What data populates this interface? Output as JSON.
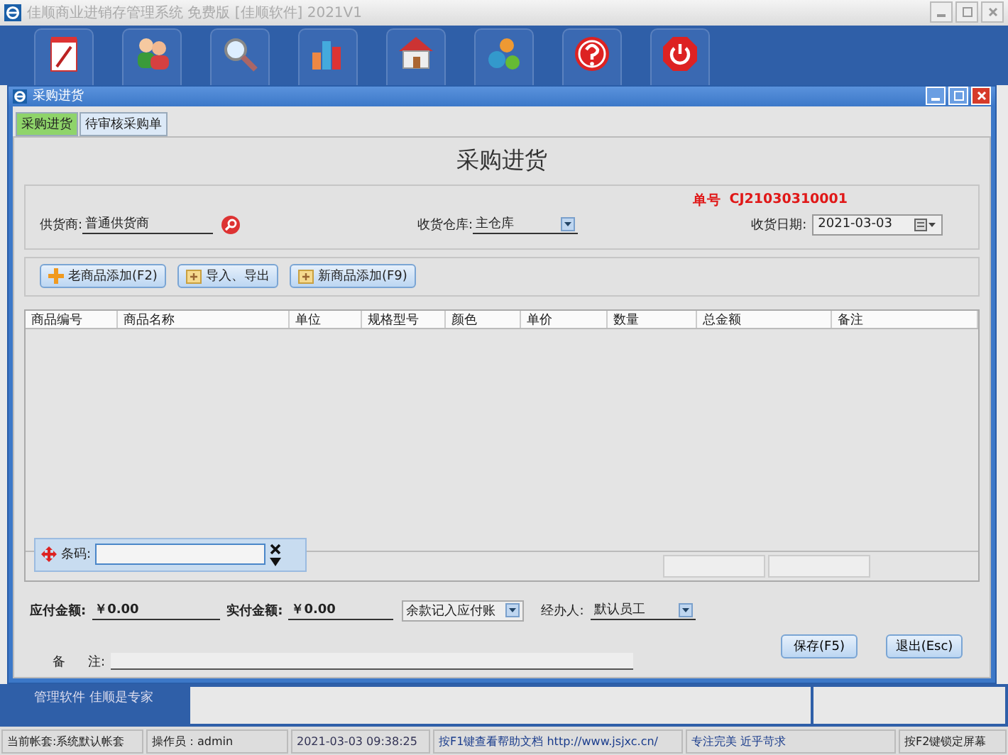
{
  "window": {
    "title": "佳顺商业进销存管理系统 免费版 [佳顺软件] 2021V1"
  },
  "toolbar": [
    {
      "kind": "note"
    },
    {
      "kind": "people"
    },
    {
      "kind": "search"
    },
    {
      "kind": "chart"
    },
    {
      "kind": "house"
    },
    {
      "kind": "abc"
    },
    {
      "kind": "help"
    },
    {
      "kind": "power"
    }
  ],
  "child_window": {
    "title": "采购进货"
  },
  "tabs": [
    {
      "label": "采购进货",
      "selected": true
    },
    {
      "label": "待审核采购单",
      "selected": false
    }
  ],
  "form": {
    "heading": "采购进货",
    "order_no_label": "单号",
    "order_no": "CJ21030310001",
    "supplier_label": "供货商:",
    "supplier": "普通供货商",
    "warehouse_label": "收货仓库:",
    "warehouse": "主仓库",
    "date_label": "收货日期:",
    "date": "2021-03-03"
  },
  "actions": [
    {
      "label": "老商品添加(F2)",
      "kind": "plus"
    },
    {
      "label": "导入、导出",
      "kind": "box"
    },
    {
      "label": "新商品添加(F9)",
      "kind": "box"
    }
  ],
  "table": {
    "columns": [
      "商品编号",
      "商品名称",
      "单位",
      "规格型号",
      "颜色",
      "单价",
      "数量",
      "总金额",
      "备注"
    ]
  },
  "barcode": {
    "label": "条码:"
  },
  "totals": {
    "payable_label": "应付金额:",
    "payable": "￥0.00",
    "paid_label": "实付金额:",
    "paid": "￥0.00",
    "balance_option": "余款记入应付账",
    "handler_label": "经办人:",
    "handler": "默认员工",
    "remark_label_1": "备",
    "remark_label_2": "注:"
  },
  "buttons": [
    "保存(F5)",
    "退出(Esc)"
  ],
  "sidebar": {
    "slogan": "管理软件 佳顺是专家"
  },
  "status_bar": [
    "当前帐套:系统默认帐套",
    "操作员：admin",
    "2021-03-03 09:38:25",
    "按F1键查看帮助文档 http://www.jsjxc.cn/",
    "专注完美 近乎苛求",
    "按F2键锁定屏幕"
  ]
}
